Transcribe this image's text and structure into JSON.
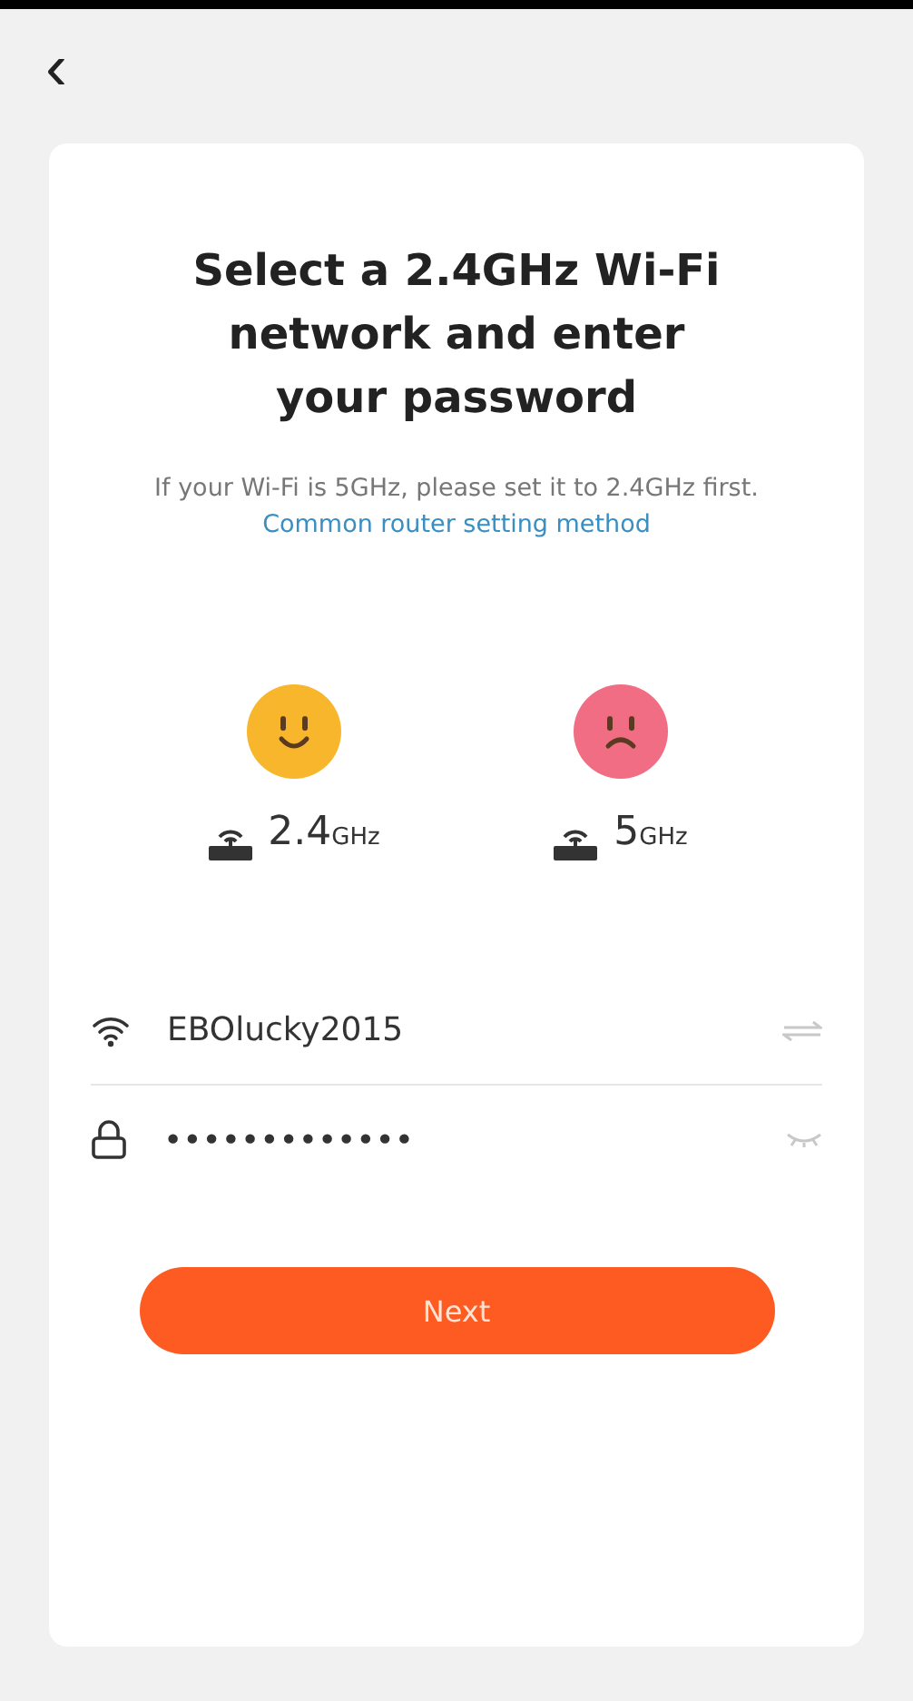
{
  "back": {
    "glyph": "‹"
  },
  "title": "Select a 2.4GHz Wi-Fi network and enter your password",
  "hint": {
    "text": "If your Wi-Fi is 5GHz, please set it to 2.4GHz first.",
    "link": "Common router setting method"
  },
  "bands": [
    {
      "value": "2.4",
      "unit": "GHz",
      "kind": "good"
    },
    {
      "value": "5",
      "unit": "GHz",
      "kind": "bad"
    }
  ],
  "network": {
    "value": "EBOlucky2015"
  },
  "password": {
    "value": "•••••••••••••"
  },
  "next_button": "Next"
}
